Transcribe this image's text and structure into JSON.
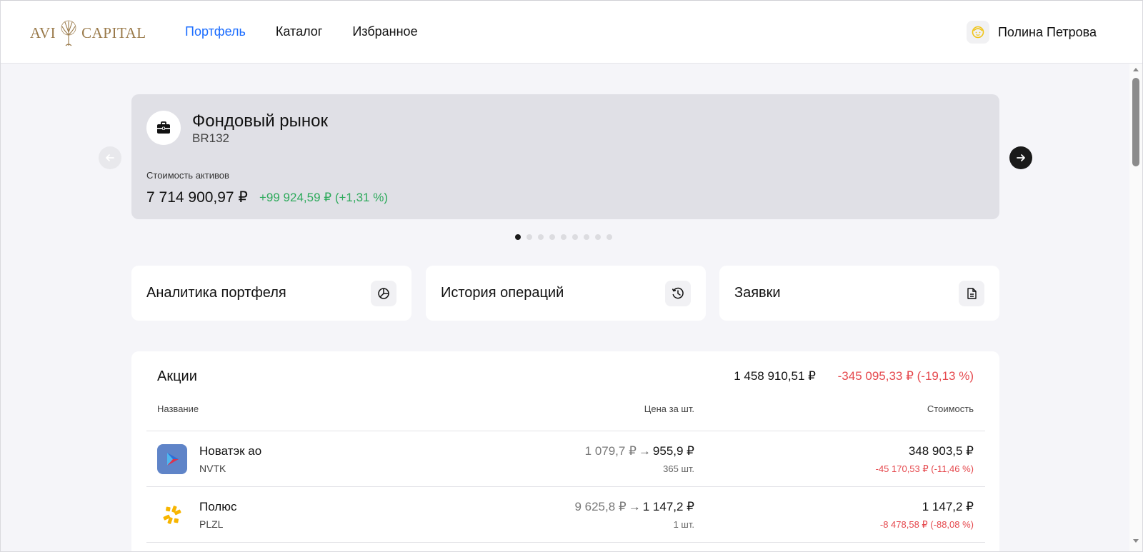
{
  "header": {
    "logo_text_left": "AVI",
    "logo_text_right": "CAPITAL",
    "nav": [
      {
        "label": "Портфель",
        "active": true
      },
      {
        "label": "Каталог",
        "active": false
      },
      {
        "label": "Избранное",
        "active": false
      }
    ],
    "user": {
      "name": "Полина Петрова",
      "avatar_icon": "face-icon"
    }
  },
  "portfolio_card": {
    "title": "Фондовый рынок",
    "account": "BR132",
    "icon": "briefcase-icon",
    "assets_label": "Стоимость активов",
    "assets_value": "7 714 900,97 ₽",
    "assets_change": "+99 924,59 ₽ (+1,31 %)",
    "carousel_total_dots": 9,
    "carousel_active_dot": 1
  },
  "actions": [
    {
      "label": "Аналитика портфеля",
      "icon": "pie-chart-icon"
    },
    {
      "label": "История операций",
      "icon": "history-icon"
    },
    {
      "label": "Заявки",
      "icon": "document-icon"
    }
  ],
  "stocks": {
    "title": "Акции",
    "total": "1 458 910,51 ₽",
    "total_change": "-345 095,33 ₽ (-19,13 %)",
    "columns": {
      "name": "Название",
      "price": "Цена за шт.",
      "value": "Стоимость"
    },
    "rows": [
      {
        "name": "Новатэк ао",
        "ticker": "NVTK",
        "price_old": "1 079,7 ₽",
        "price_arrow": "→",
        "price_new": "955,9 ₽",
        "qty": "365 шт.",
        "value": "348 903,5 ₽",
        "value_change": "-45 170,53 ₽ (-11,46 %)"
      },
      {
        "name": "Полюс",
        "ticker": "PLZL",
        "price_old": "9 625,8 ₽",
        "price_arrow": "→",
        "price_new": "1 147,2 ₽",
        "qty": "1 шт.",
        "value": "1 147,2 ₽",
        "value_change": "-8 478,58 ₽ (-88,08 %)"
      }
    ]
  },
  "colors": {
    "accent": "#1a6cff",
    "positive": "#2eaa5c",
    "negative": "#e5484d",
    "logo": "#9a7a4a"
  }
}
